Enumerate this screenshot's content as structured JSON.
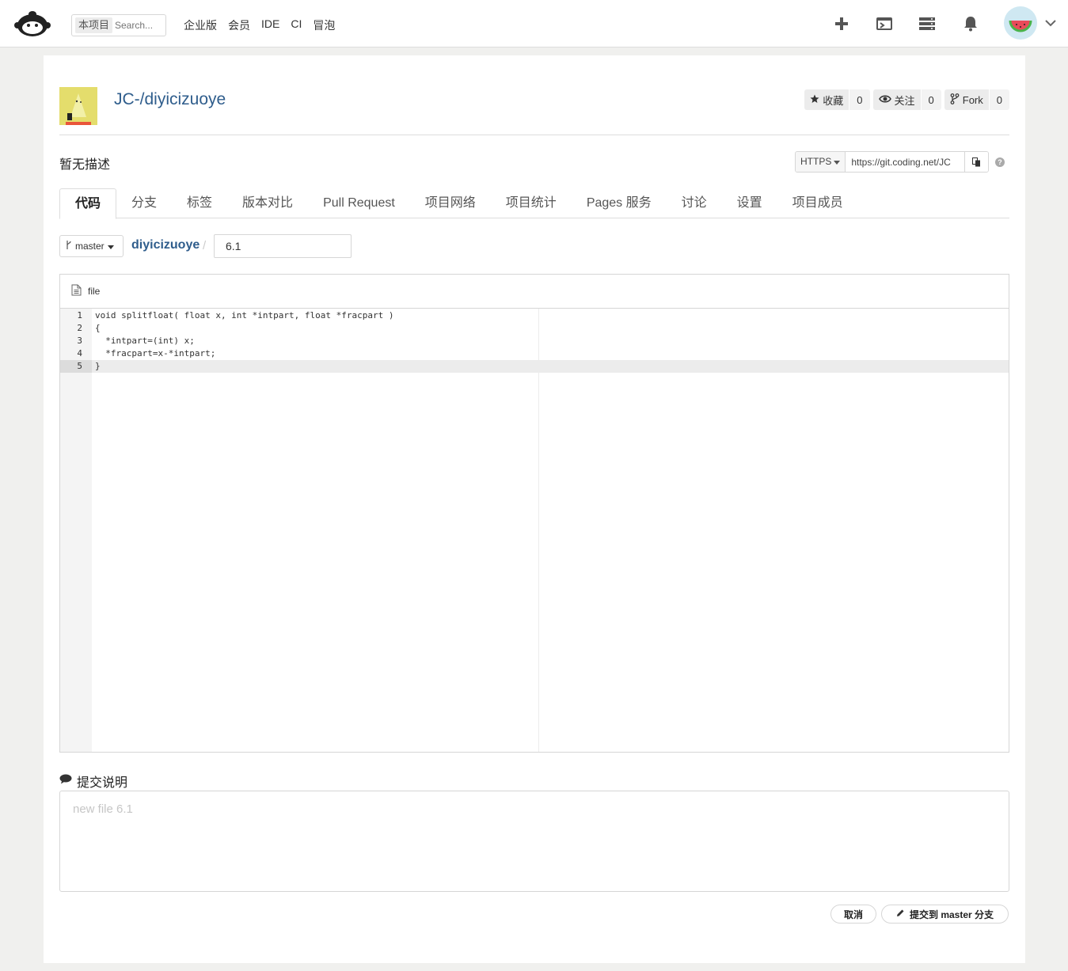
{
  "topbar": {
    "search_scope": "本项目",
    "search_placeholder": "Search...",
    "nav": [
      "企业版",
      "会员",
      "IDE",
      "CI",
      "冒泡"
    ]
  },
  "repo": {
    "title": "JC-/diyicizuoye",
    "star_label": "收藏",
    "star_count": "0",
    "watch_label": "关注",
    "watch_count": "0",
    "fork_label": "Fork",
    "fork_count": "0",
    "description": "暂无描述",
    "clone_protocol": "HTTPS",
    "clone_url": "https://git.coding.net/JC"
  },
  "tabs": [
    "代码",
    "分支",
    "标签",
    "版本对比",
    "Pull Request",
    "项目网络",
    "项目统计",
    "Pages 服务",
    "讨论",
    "设置",
    "项目成员"
  ],
  "active_tab": "代码",
  "path": {
    "branch": "master",
    "repo_name": "diyicizuoye",
    "separator": "/",
    "file_name": "6.1"
  },
  "editor": {
    "mode_label": "file",
    "lines": [
      {
        "n": "1",
        "text": "void splitfloat( float x, int *intpart, float *fracpart )"
      },
      {
        "n": "2",
        "text": "{"
      },
      {
        "n": "3",
        "text": "  *intpart=(int) x;"
      },
      {
        "n": "4",
        "text": "  *fracpart=x-*intpart;"
      },
      {
        "n": "5",
        "text": "}"
      }
    ],
    "current_line": 5
  },
  "commit": {
    "label": "提交说明",
    "placeholder": "new file 6.1",
    "cancel": "取消",
    "submit": "提交到 master 分支"
  },
  "colors": {
    "link": "#2f5d8c",
    "panel": "#ffffff",
    "background": "#f0f0ee"
  }
}
